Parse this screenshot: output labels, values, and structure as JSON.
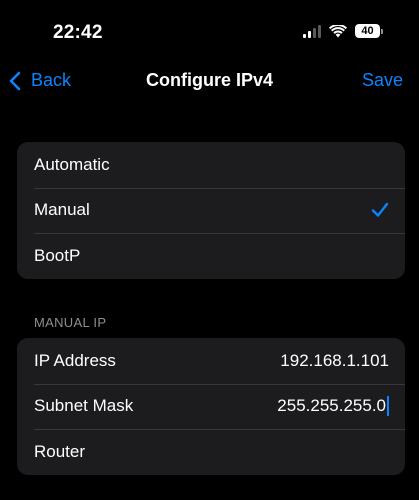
{
  "status_bar": {
    "time": "22:42",
    "battery_level": "40"
  },
  "nav": {
    "back_label": "Back",
    "title": "Configure IPv4",
    "save_label": "Save"
  },
  "config_modes": {
    "items": [
      {
        "label": "Automatic",
        "selected": false
      },
      {
        "label": "Manual",
        "selected": true
      },
      {
        "label": "BootP",
        "selected": false
      }
    ]
  },
  "manual_ip": {
    "header": "MANUAL IP",
    "fields": [
      {
        "label": "IP Address",
        "value": "192.168.1.101"
      },
      {
        "label": "Subnet Mask",
        "value": "255.255.255.0"
      },
      {
        "label": "Router",
        "value": ""
      }
    ]
  },
  "colors": {
    "accent": "#0a84ff",
    "background": "#000000",
    "cell_background": "#1c1c1e",
    "separator": "#38383a",
    "secondary_text": "#8e8e93"
  }
}
